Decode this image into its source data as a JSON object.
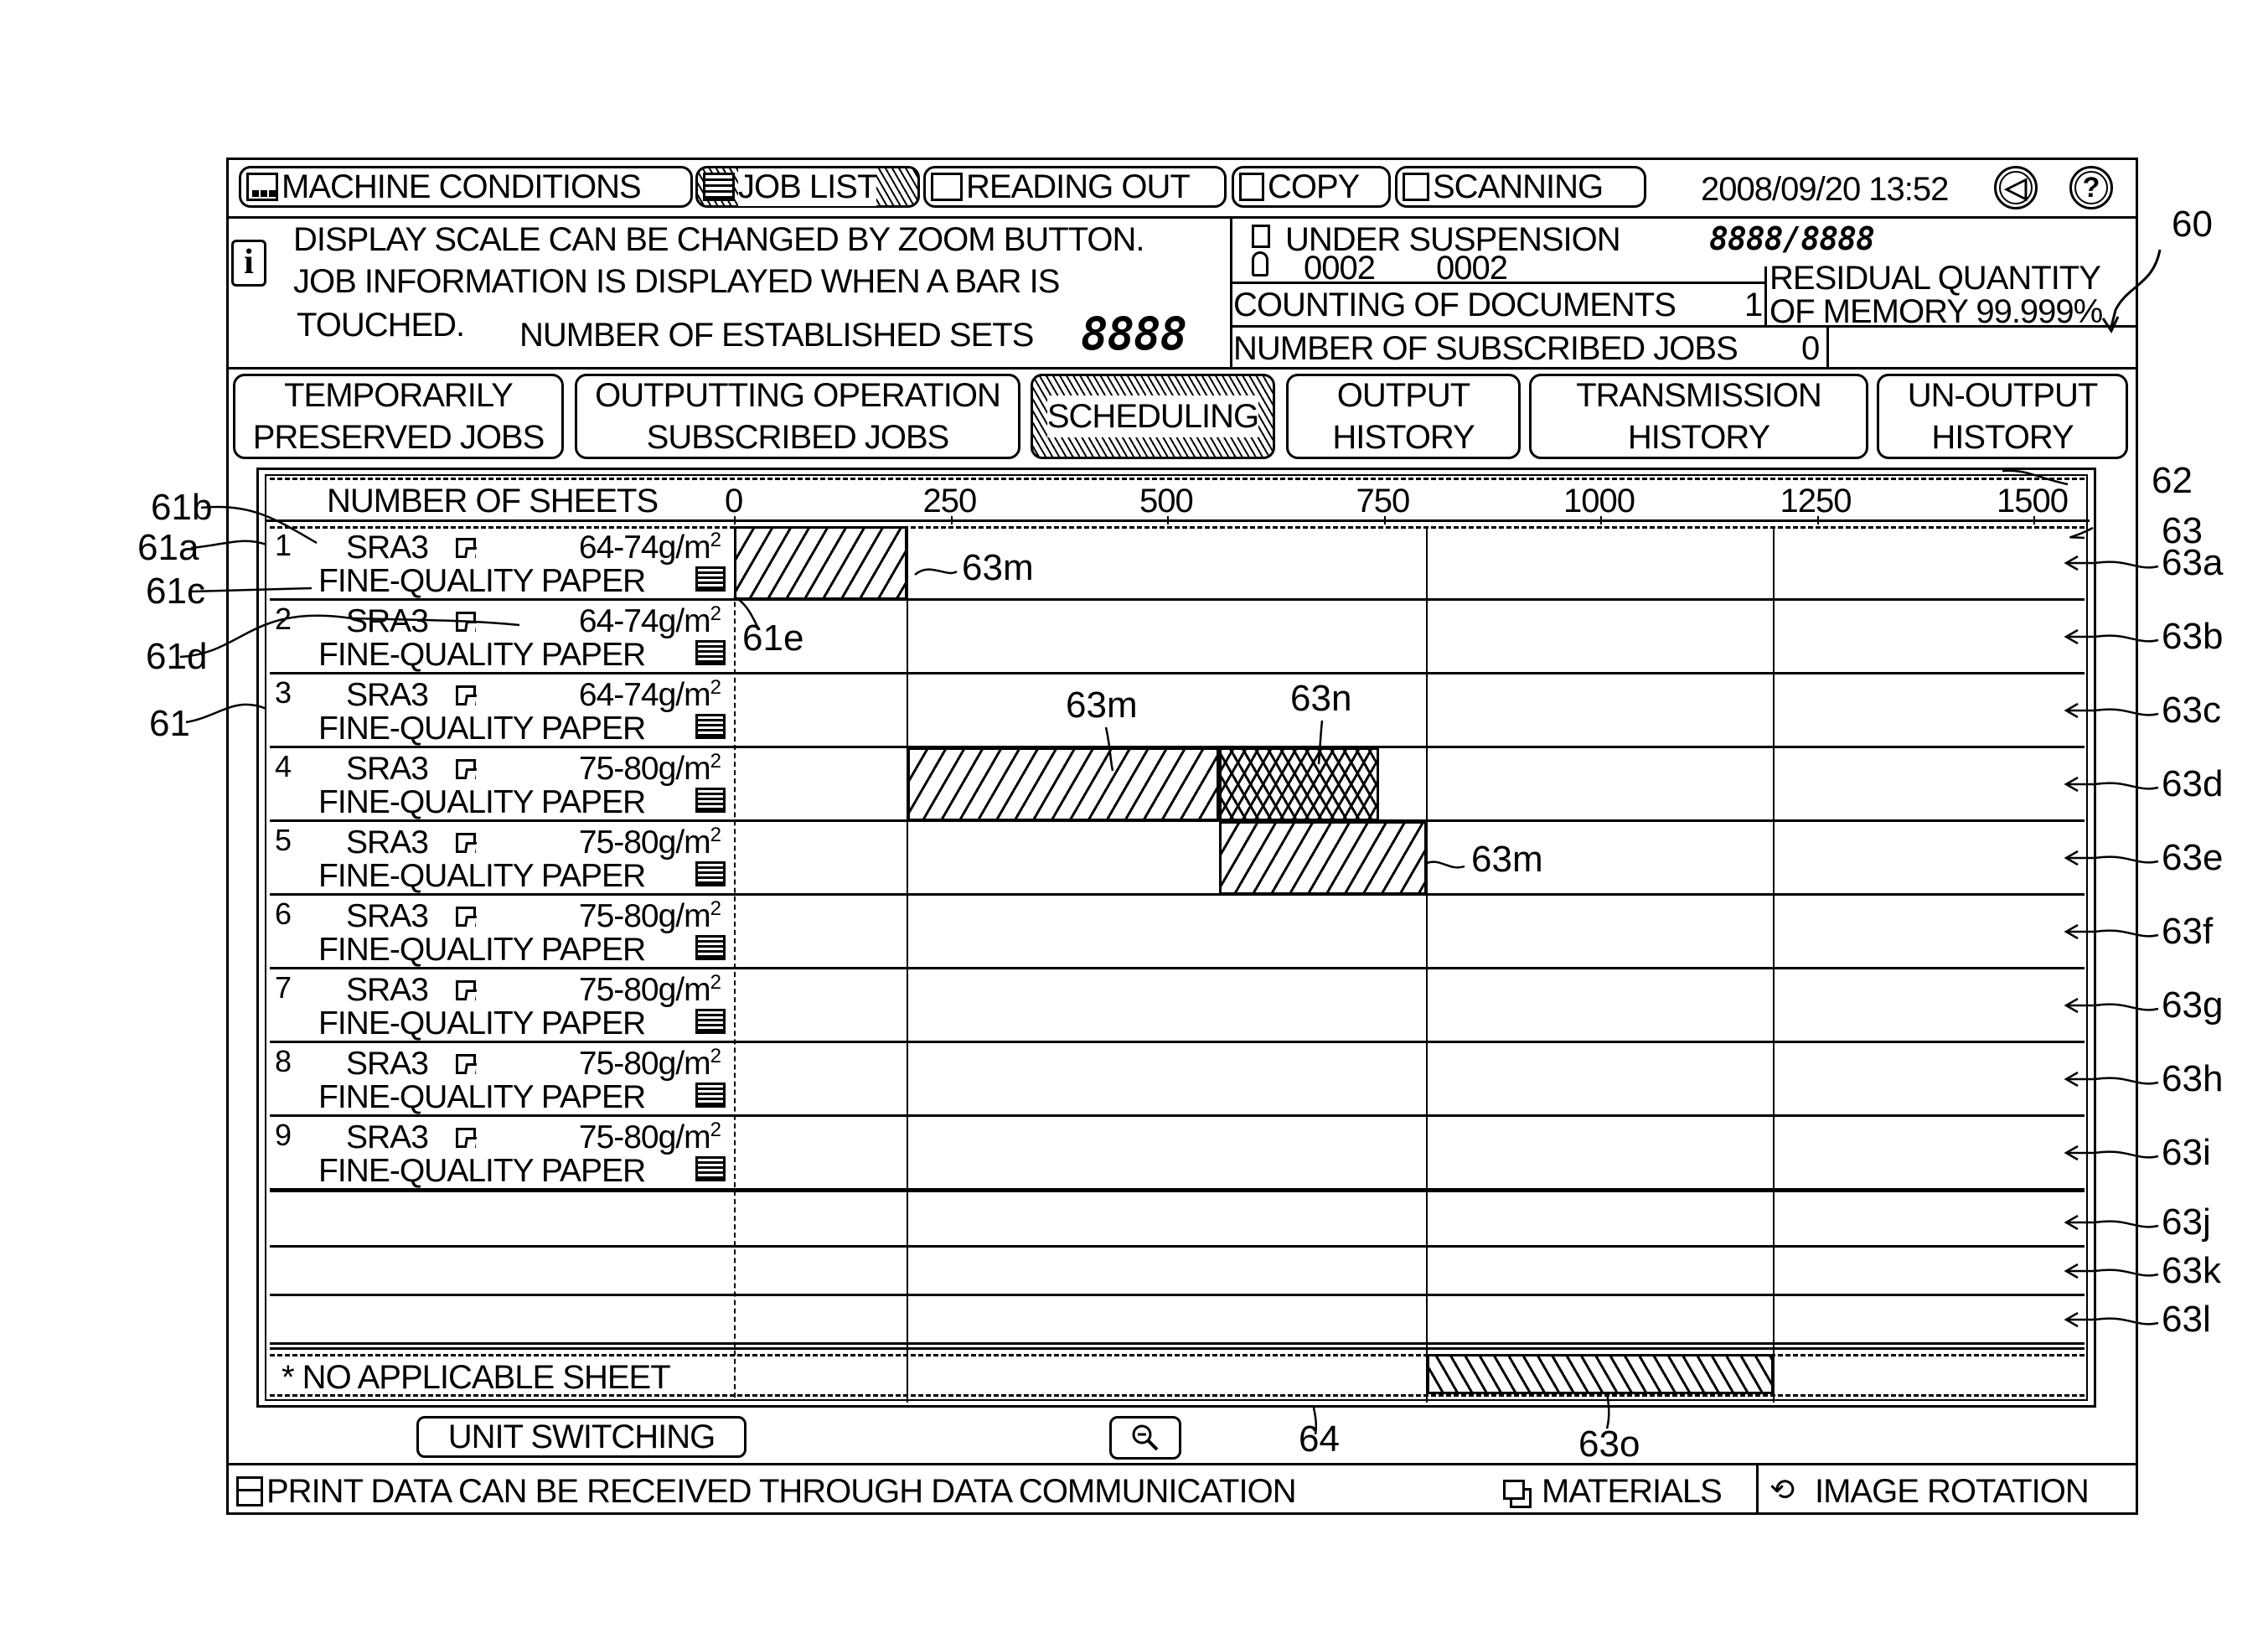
{
  "top_bar": {
    "buttons": [
      {
        "label": "MACHINE CONDITIONS",
        "icon": "machine-icon",
        "active": false
      },
      {
        "label": "JOB LIST",
        "icon": "list-icon",
        "active": true
      },
      {
        "label": "READING OUT",
        "icon": "reading-icon",
        "active": false
      },
      {
        "label": "COPY",
        "icon": "copy-icon",
        "active": false
      },
      {
        "label": "SCANNING",
        "icon": "scan-icon",
        "active": false
      }
    ],
    "datetime": "2008/09/20 13:52",
    "volume_icon": "speaker-icon",
    "help_icon": "question-icon",
    "help_glyph": "?"
  },
  "info_panel": {
    "icon_glyph": "i",
    "line1": "DISPLAY SCALE CAN BE CHANGED BY ZOOM BUTTON.",
    "line2": "JOB INFORMATION IS DISPLAYED WHEN A BAR IS",
    "line3": "TOUCHED.",
    "sets_label": "NUMBER OF ESTABLISHED SETS",
    "sets_value": "8888"
  },
  "status_panel": {
    "suspension_label": "UNDER SUSPENSION",
    "suspension_value": "8888/8888",
    "user_value_1": "0002",
    "user_value_2": "0002",
    "counting_label": "COUNTING OF DOCUMENTS",
    "counting_value": "1",
    "memory_line1": "RESIDUAL QUANTITY",
    "memory_line2": "OF MEMORY 99.999%",
    "subscribed_label": "NUMBER OF SUBSCRIBED JOBS",
    "subscribed_value": "0"
  },
  "tabs": [
    {
      "line1": "TEMPORARILY",
      "line2": "PRESERVED JOBS",
      "active": false
    },
    {
      "line1": "OUTPUTTING OPERATION",
      "line2": "SUBSCRIBED JOBS",
      "active": false
    },
    {
      "line1": "SCHEDULING",
      "line2": "",
      "active": true
    },
    {
      "line1": "OUTPUT",
      "line2": "HISTORY",
      "active": false
    },
    {
      "line1": "TRANSMISSION",
      "line2": "HISTORY",
      "active": false
    },
    {
      "line1": "UN-OUTPUT",
      "line2": "HISTORY",
      "active": false
    }
  ],
  "chart_data": {
    "type": "bar",
    "title": "",
    "xlabel": "NUMBER OF SHEETS",
    "ylabel": "",
    "xlim": [
      0,
      1500
    ],
    "x_ticks": [
      0,
      250,
      500,
      750,
      1000,
      1250,
      1500
    ],
    "gridlines_at": [
      200,
      800,
      1200
    ],
    "rows": [
      {
        "num": "1",
        "size": "SRA3",
        "weight": "64-74g/m",
        "weight_sup": "2",
        "type": "FINE-QUALITY PAPER"
      },
      {
        "num": "2",
        "size": "SRA3",
        "weight": "64-74g/m",
        "weight_sup": "2",
        "type": "FINE-QUALITY PAPER"
      },
      {
        "num": "3",
        "size": "SRA3",
        "weight": "64-74g/m",
        "weight_sup": "2",
        "type": "FINE-QUALITY PAPER"
      },
      {
        "num": "4",
        "size": "SRA3",
        "weight": "75-80g/m",
        "weight_sup": "2",
        "type": "FINE-QUALITY PAPER"
      },
      {
        "num": "5",
        "size": "SRA3",
        "weight": "75-80g/m",
        "weight_sup": "2",
        "type": "FINE-QUALITY PAPER"
      },
      {
        "num": "6",
        "size": "SRA3",
        "weight": "75-80g/m",
        "weight_sup": "2",
        "type": "FINE-QUALITY PAPER"
      },
      {
        "num": "7",
        "size": "SRA3",
        "weight": "75-80g/m",
        "weight_sup": "2",
        "type": "FINE-QUALITY PAPER"
      },
      {
        "num": "8",
        "size": "SRA3",
        "weight": "75-80g/m",
        "weight_sup": "2",
        "type": "FINE-QUALITY PAPER"
      },
      {
        "num": "9",
        "size": "SRA3",
        "weight": "75-80g/m",
        "weight_sup": "2",
        "type": "FINE-QUALITY PAPER"
      },
      {
        "num": "",
        "size": "",
        "weight": "",
        "weight_sup": "",
        "type": ""
      },
      {
        "num": "",
        "size": "",
        "weight": "",
        "weight_sup": "",
        "type": ""
      },
      {
        "num": "",
        "size": "",
        "weight": "",
        "weight_sup": "",
        "type": ""
      }
    ],
    "bars": [
      {
        "row": 0,
        "start": 0,
        "end": 200,
        "pattern": "m"
      },
      {
        "row": 3,
        "start": 200,
        "end": 560,
        "pattern": "m"
      },
      {
        "row": 3,
        "start": 560,
        "end": 745,
        "pattern": "n"
      },
      {
        "row": 4,
        "start": 560,
        "end": 800,
        "pattern": "m"
      },
      {
        "row": "no-applicable",
        "start": 800,
        "end": 1200,
        "pattern": "o"
      }
    ],
    "no_applicable_label": "* NO APPLICABLE SHEET"
  },
  "controls": {
    "unit_switching": "UNIT SWITCHING",
    "zoom_icon": "zoom-out-icon"
  },
  "footer": {
    "message": "PRINT DATA CAN BE RECEIVED THROUGH DATA COMMUNICATION",
    "materials": "MATERIALS",
    "image_rotation": "IMAGE ROTATION"
  },
  "reference_labels": {
    "r60": "60",
    "r61": "61",
    "r61a": "61a",
    "r61b": "61b",
    "r61c": "61c",
    "r61d": "61d",
    "r61e": "61e",
    "r62": "62",
    "r63": "63",
    "r63a": "63a",
    "r63b": "63b",
    "r63c": "63c",
    "r63d": "63d",
    "r63e": "63e",
    "r63f": "63f",
    "r63g": "63g",
    "r63h": "63h",
    "r63i": "63i",
    "r63j": "63j",
    "r63k": "63k",
    "r63l": "63l",
    "r63m": "63m",
    "r63n": "63n",
    "r63o": "63o",
    "r64": "64"
  }
}
